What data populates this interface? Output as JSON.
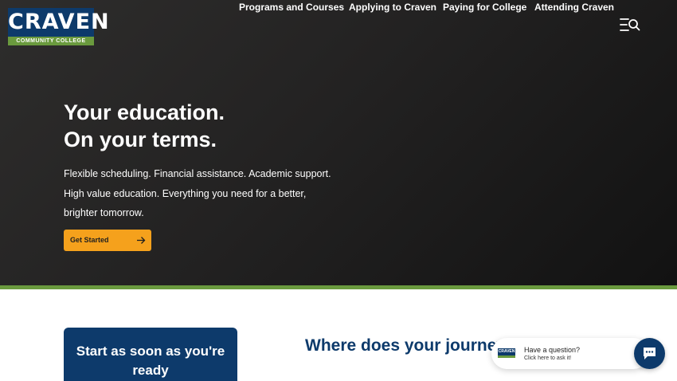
{
  "logo": {
    "name": "CRAVEN",
    "tagline": "COMMUNITY COLLEGE"
  },
  "nav": {
    "items": [
      {
        "label": "Programs and Courses"
      },
      {
        "label": "Applying to Craven"
      },
      {
        "label": "Paying for College"
      },
      {
        "label": "Attending Craven"
      }
    ],
    "menu_icon": "menu-search-icon"
  },
  "hero": {
    "title_line1": "Your education.",
    "title_line2": "On your terms.",
    "body": "Flexible scheduling. Financial assistance. Academic support. High value education. Everything you need for a better, brighter tomorrow.",
    "cta_label": "Get Started",
    "cta_icon": "arrow-right-icon"
  },
  "card": {
    "text": "Start as soon as you're ready"
  },
  "section": {
    "title": "Where does your journey start?"
  },
  "chat": {
    "logo_text": "CRAVEN",
    "title": "Have a question?",
    "subtitle": "Click here to ask it!",
    "button_icon": "chat-icon"
  },
  "colors": {
    "brand_navy": "#0d3a6b",
    "brand_green": "#6a9a3e",
    "accent_orange": "#f5a11c",
    "hero_dark": "#1c1c1c"
  }
}
